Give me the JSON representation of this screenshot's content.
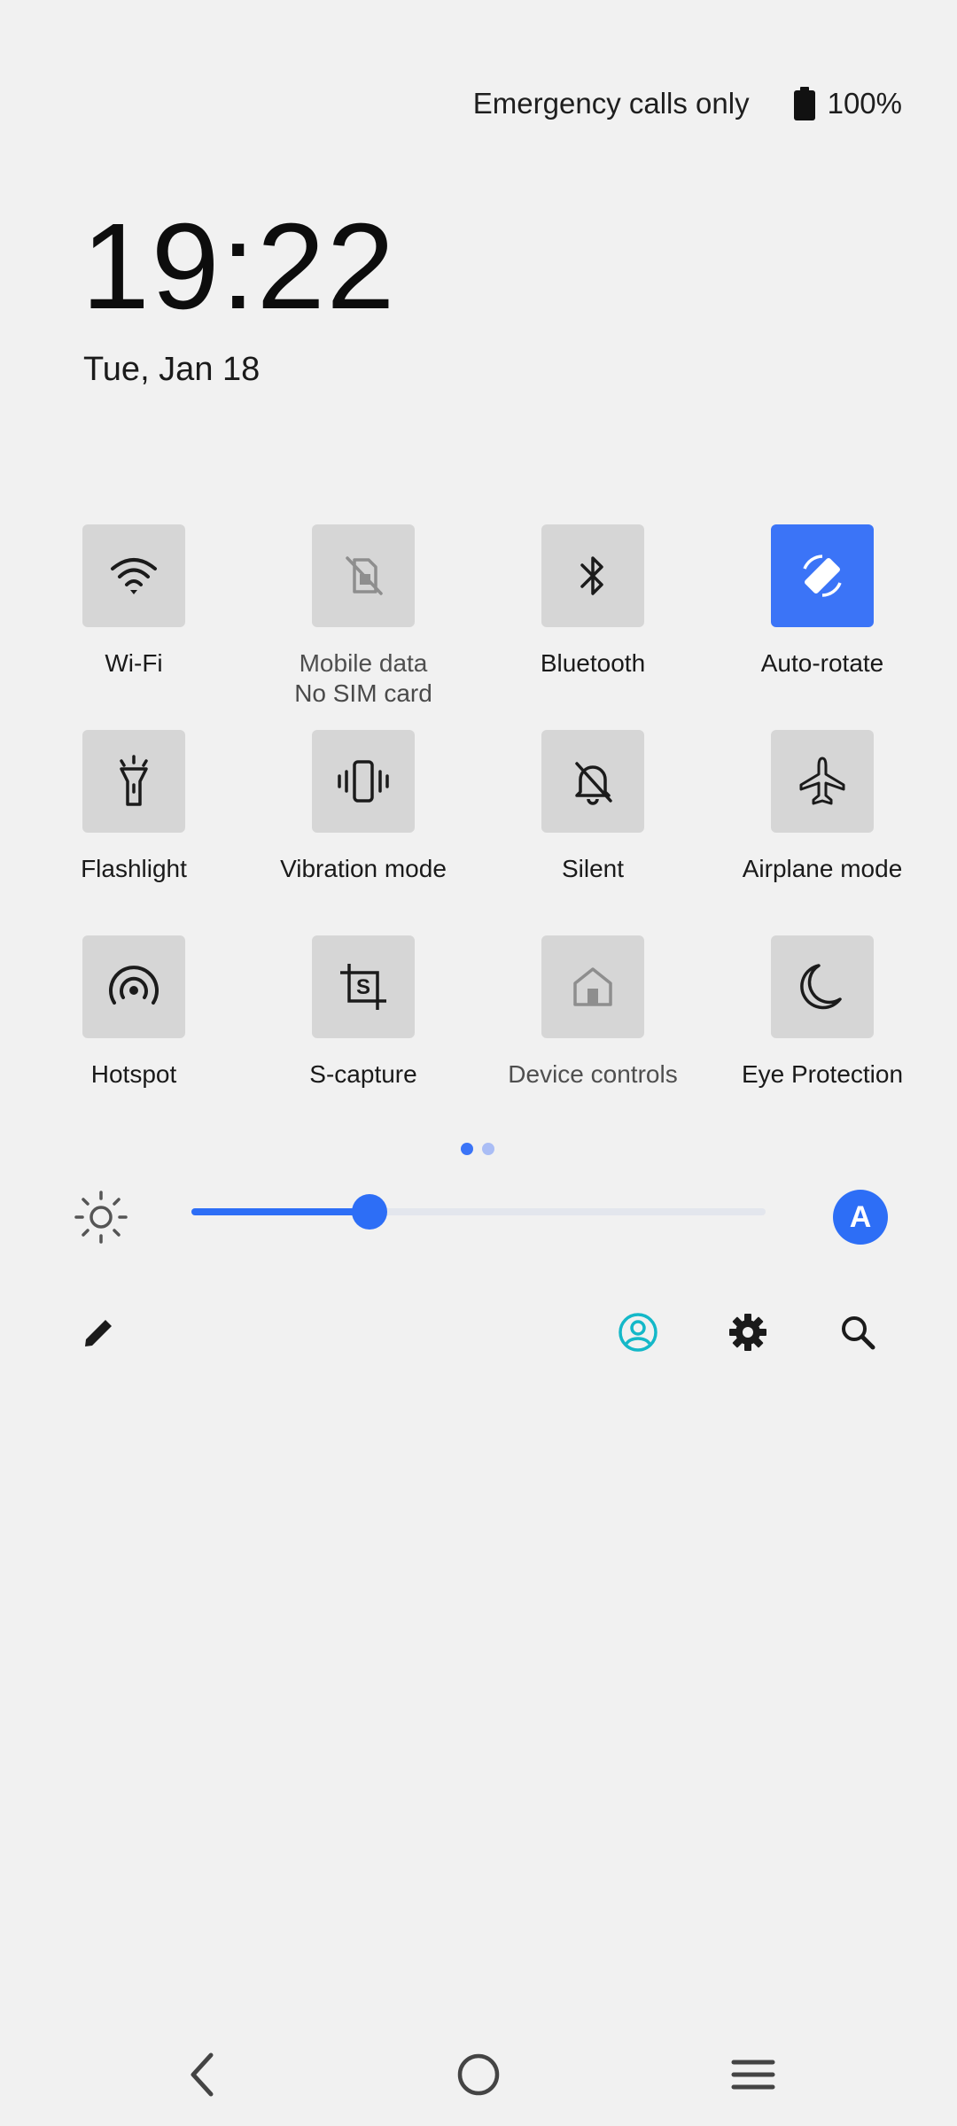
{
  "status_bar": {
    "network_text": "Emergency calls only",
    "battery_icon": "battery-full-icon",
    "battery_percent": "100%"
  },
  "clock": {
    "time": "19:22",
    "date": "Tue, Jan 18"
  },
  "tiles": [
    {
      "label": "Wi-Fi",
      "sub": "",
      "icon": "wifi-icon",
      "state": "off"
    },
    {
      "label": "Mobile data",
      "sub": "No SIM card",
      "icon": "mobile-data-off-icon",
      "state": "disabled"
    },
    {
      "label": "Bluetooth",
      "sub": "",
      "icon": "bluetooth-icon",
      "state": "off"
    },
    {
      "label": "Auto-rotate",
      "sub": "",
      "icon": "auto-rotate-icon",
      "state": "on"
    },
    {
      "label": "Flashlight",
      "sub": "",
      "icon": "flashlight-icon",
      "state": "off"
    },
    {
      "label": "Vibration mode",
      "sub": "",
      "icon": "vibration-icon",
      "state": "off"
    },
    {
      "label": "Silent",
      "sub": "",
      "icon": "silent-bell-off-icon",
      "state": "off"
    },
    {
      "label": "Airplane mode",
      "sub": "",
      "icon": "airplane-icon",
      "state": "off"
    },
    {
      "label": "Hotspot",
      "sub": "",
      "icon": "hotspot-icon",
      "state": "off"
    },
    {
      "label": "S-capture",
      "sub": "",
      "icon": "s-capture-icon",
      "state": "off"
    },
    {
      "label": "Device controls",
      "sub": "",
      "icon": "home-icon",
      "state": "disabled"
    },
    {
      "label": "Eye Protection",
      "sub": "",
      "icon": "moon-icon",
      "state": "off"
    }
  ],
  "pager": {
    "pages": 2,
    "current": 1
  },
  "brightness": {
    "icon": "brightness-icon",
    "level": 0.31,
    "auto_label": "A"
  },
  "actions": {
    "edit_icon": "pencil-icon",
    "user_icon": "user-account-icon",
    "settings_icon": "gear-icon",
    "search_icon": "search-icon"
  },
  "navigation": {
    "back_icon": "back-chevron-icon",
    "home_icon": "home-circle-icon",
    "recents_icon": "menu-lines-icon"
  },
  "colors": {
    "accent": "#3b74f7",
    "tile_bg": "#d6d6d6",
    "background": "#f1f1f1",
    "user_icon": "#14b8c8"
  }
}
